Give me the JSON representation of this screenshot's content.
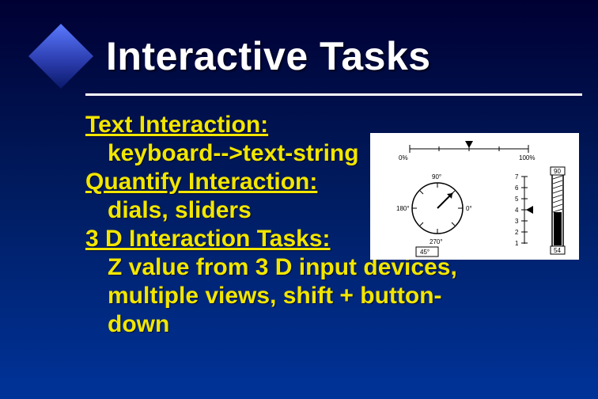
{
  "title": "Interactive Tasks",
  "body": {
    "h1": "Text Interaction:",
    "l1": "keyboard-->text-string",
    "h2": "Quantify Interaction:",
    "l2": "dials,  sliders",
    "h3": "3 D Interaction Tasks:",
    "l3": "Z value from 3 D input devices,",
    "l4": "multiple views, shift + button-",
    "l5": "down"
  },
  "figure": {
    "slider_h": {
      "left_label": "0%",
      "right_label": "100%"
    },
    "dial": {
      "top": "90°",
      "left": "180°",
      "right": "0°",
      "bottom": "270°",
      "value_box": "45°"
    },
    "scale": {
      "ticks": [
        "7",
        "6",
        "5",
        "4",
        "3",
        "2",
        "1"
      ]
    },
    "thermo": {
      "top": "90",
      "bottom": "54"
    }
  }
}
